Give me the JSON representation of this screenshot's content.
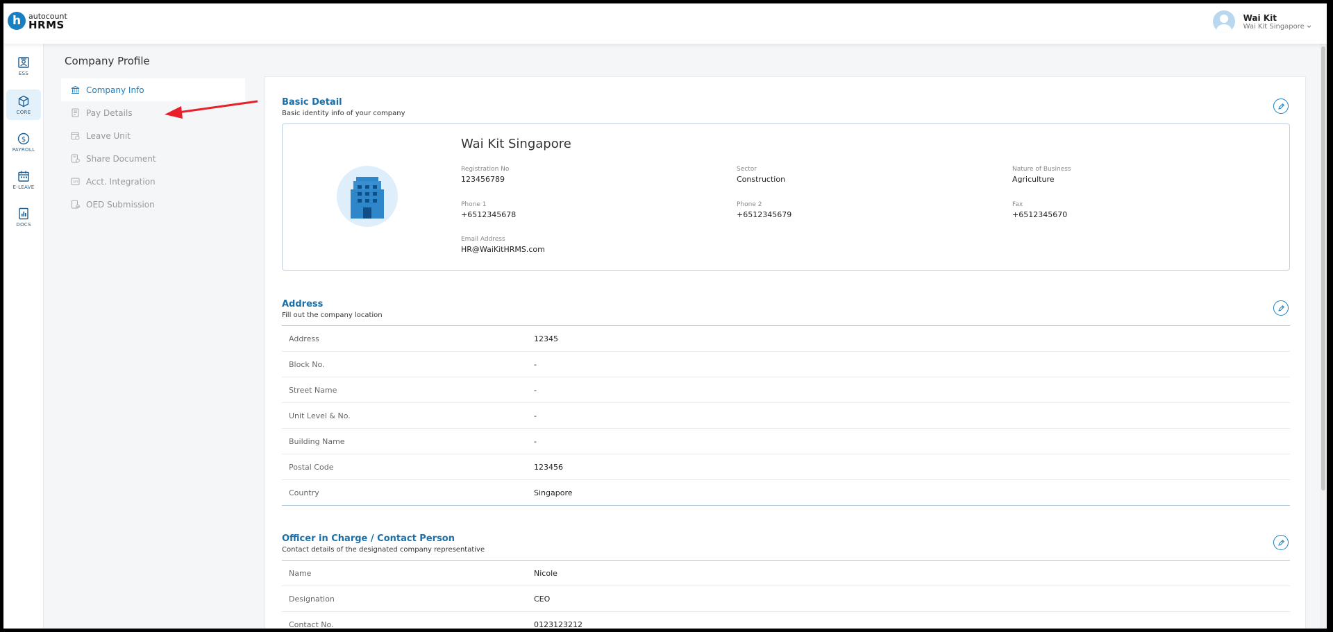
{
  "header": {
    "logo_small": "autocount",
    "logo_big": "HRMS",
    "user_name": "Wai Kit",
    "user_company": "Wai Kit Singapore"
  },
  "rail": {
    "ess": "ESS",
    "core": "CORE",
    "payroll": "PAYROLL",
    "eleave": "E-LEAVE",
    "docs": "DOCS"
  },
  "page": {
    "title": "Company Profile"
  },
  "subnav": {
    "company_info": "Company Info",
    "pay_details": "Pay Details",
    "leave_unit": "Leave Unit",
    "share_document": "Share Document",
    "acct_integration": "Acct. Integration",
    "oed_submission": "OED Submission"
  },
  "basic": {
    "title": "Basic Detail",
    "subtitle": "Basic identity info of your company",
    "company_name": "Wai Kit Singapore",
    "registration_label": "Registration No",
    "registration_value": "123456789",
    "sector_label": "Sector",
    "sector_value": "Construction",
    "nature_label": "Nature of Business",
    "nature_value": "Agriculture",
    "phone1_label": "Phone 1",
    "phone1_value": "+6512345678",
    "phone2_label": "Phone 2",
    "phone2_value": "+6512345679",
    "fax_label": "Fax",
    "fax_value": "+6512345670",
    "email_label": "Email Address",
    "email_value": "HR@WaiKitHRMS.com"
  },
  "address": {
    "title": "Address",
    "subtitle": "Fill out the company location",
    "rows": [
      {
        "label": "Address",
        "value": "12345"
      },
      {
        "label": "Block No.",
        "value": "-"
      },
      {
        "label": "Street Name",
        "value": "-"
      },
      {
        "label": "Unit Level & No.",
        "value": "-"
      },
      {
        "label": "Building Name",
        "value": "-"
      },
      {
        "label": "Postal Code",
        "value": "123456"
      },
      {
        "label": "Country",
        "value": "Singapore"
      }
    ]
  },
  "officer": {
    "title": "Officer in Charge / Contact Person",
    "subtitle": "Contact details of the designated company representative",
    "rows": [
      {
        "label": "Name",
        "value": "Nicole"
      },
      {
        "label": "Designation",
        "value": "CEO"
      },
      {
        "label": "Contact No.",
        "value": "0123123212"
      }
    ]
  },
  "colors": {
    "brand": "#1a7fc1",
    "section_title": "#1a6fa8",
    "annotation_arrow": "#e8202a"
  }
}
